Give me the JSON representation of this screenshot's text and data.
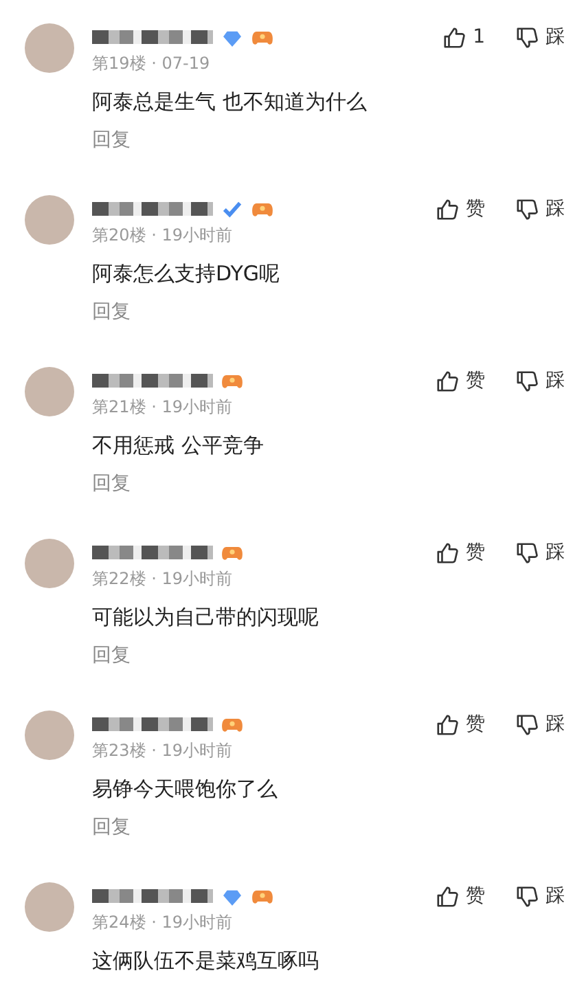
{
  "comments": [
    {
      "kind": "gem",
      "floor": "第19楼 · 07-19",
      "content": "阿泰总是生气 也不知道为什么",
      "like": "1",
      "dislike": "踩",
      "reply": "回复"
    },
    {
      "kind": "check",
      "floor": "第20楼 · 19小时前",
      "content": "阿泰怎么支持DYG呢",
      "like": "赞",
      "dislike": "踩",
      "reply": "回复"
    },
    {
      "kind": "plain",
      "floor": "第21楼 · 19小时前",
      "content": "不用惩戒 公平竞争",
      "like": "赞",
      "dislike": "踩",
      "reply": "回复"
    },
    {
      "kind": "plain",
      "floor": "第22楼 · 19小时前",
      "content": "可能以为自己带的闪现呢",
      "like": "赞",
      "dislike": "踩",
      "reply": "回复"
    },
    {
      "kind": "plain",
      "floor": "第23楼 · 19小时前",
      "content": "易铮今天喂饱你了么",
      "like": "赞",
      "dislike": "踩",
      "reply": "回复"
    },
    {
      "kind": "gem",
      "floor": "第24楼 · 19小时前",
      "content": "这俩队伍不是菜鸡互啄吗",
      "like": "赞",
      "dislike": "踩"
    }
  ]
}
